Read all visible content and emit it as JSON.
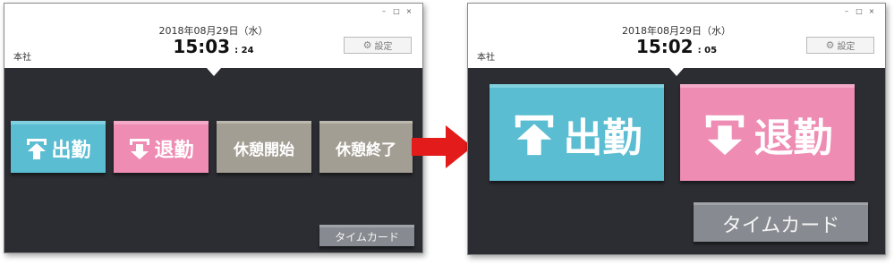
{
  "left_screen": {
    "window_controls": [
      "–",
      "□",
      "×"
    ],
    "date": "2018年08月29日（水）",
    "time_hm": "15:03",
    "time_sec": ": 24",
    "company": "本社",
    "settings_label": "設定",
    "buttons": {
      "clock_in": "出勤",
      "clock_out": "退勤",
      "break_start": "休憩開始",
      "break_end": "休憩終了",
      "timecard": "タイムカード"
    }
  },
  "right_screen": {
    "window_controls": [
      "–",
      "□",
      "×"
    ],
    "date": "2018年08月29日（水）",
    "time_hm": "15:02",
    "time_sec": ": 05",
    "company": "本社",
    "settings_label": "設定",
    "buttons": {
      "clock_in": "出勤",
      "clock_out": "退勤",
      "timecard": "タイムカード"
    }
  },
  "colors": {
    "clock_in": "#5bbdd1",
    "clock_out": "#ee8cb3",
    "break": "#a39e94",
    "timecard": "#878a90",
    "panel": "#2b2d33",
    "arrow": "#e31b1b"
  },
  "icons": {
    "clock_in": "upload-arrow-icon",
    "clock_out": "download-arrow-icon",
    "settings": "gear-icon",
    "transition": "red-arrow-icon"
  }
}
